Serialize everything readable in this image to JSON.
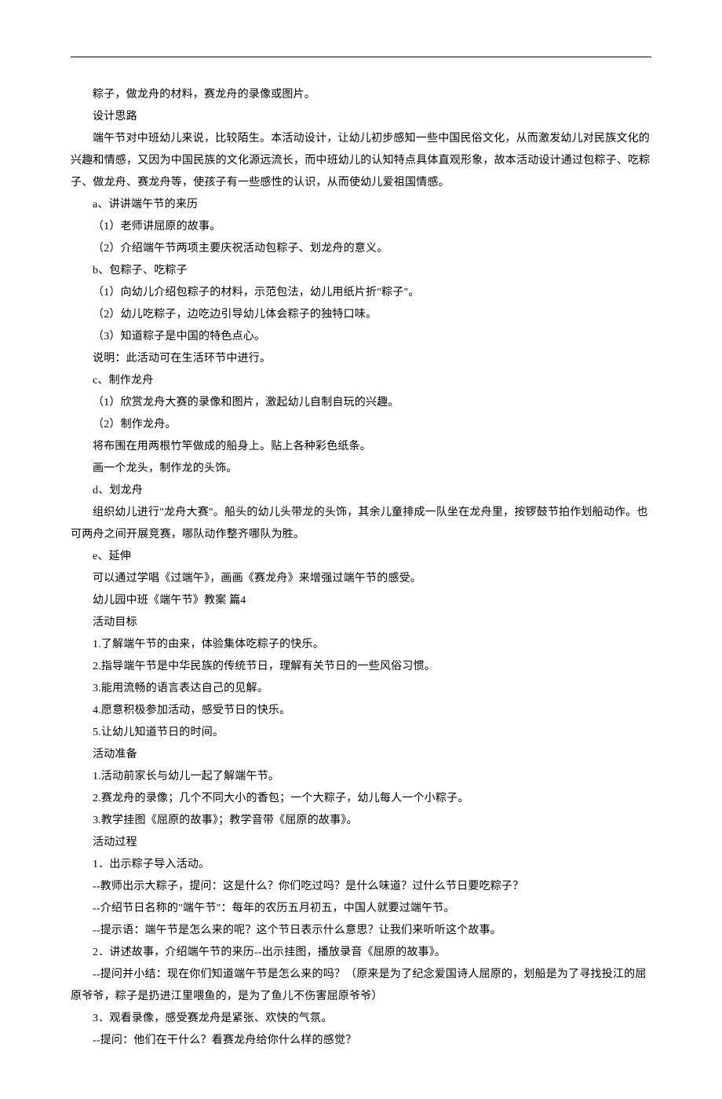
{
  "lines": [
    "粽子，做龙舟的材料，赛龙舟的录像或图片。",
    "设计思路",
    "端午节对中班幼儿来说，比较陌生。本活动设计，让幼儿初步感知一些中国民俗文化，从而激发幼儿对民族文化的兴趣和情感，又因为中国民族的文化源远流长，而中班幼儿的认知特点具体直观形象，故本活动设计通过包粽子、吃粽子、做龙舟、赛龙舟等，使孩子有一些感性的认识，从而使幼儿爱祖国情感。",
    "a、讲讲端午节的来历",
    "（1）老师讲屈原的故事。",
    "（2）介绍端午节两项主要庆祝活动包粽子、划龙舟的意义。",
    "b、包粽子、吃粽子",
    "（1）向幼儿介绍包粽子的材料，示范包法，幼儿用纸片折\"粽子\"。",
    "（2）幼儿吃粽子，边吃边引导幼儿体会粽子的独特口味。",
    "（3）知道粽子是中国的特色点心。",
    "说明：此活动可在生活环节中进行。",
    "c、制作龙舟",
    "（1）欣赏龙舟大赛的录像和图片，激起幼儿自制自玩的兴趣。",
    "（2）制作龙舟。",
    "将布围在用两根竹竿做成的船身上。贴上各种彩色纸条。",
    "画一个龙头，制作龙的头饰。",
    "d、划龙舟",
    "组织幼儿进行\"龙舟大赛\"。船头的幼儿头带龙的头饰，其余儿童排成一队坐在龙舟里，按锣鼓节拍作划船动作。也可两舟之间开展竞赛，哪队动作整齐哪队为胜。",
    "e、延伸",
    "可以通过学唱《过端午》，画画《赛龙舟》来增强过端午节的感受。",
    "幼儿园中班《端午节》教案 篇4",
    "活动目标",
    "1.了解端午节的由来，体验集体吃粽子的快乐。",
    "2.指导端午节是中华民族的传统节日，理解有关节日的一些风俗习惯。",
    "3.能用流畅的语言表达自己的见解。",
    "4.愿意积极参加活动，感受节日的快乐。",
    "5.让幼儿知道节日的时间。",
    "活动准备",
    "1.活动前家长与幼儿一起了解端午节。",
    "2.赛龙舟的录像；几个不同大小的香包；一个大粽子，幼儿每人一个小粽子。",
    "3.教学挂图《屈原的故事》；教学音带《屈原的故事》。",
    "活动过程",
    "1．出示粽子导入活动。",
    "--教师出示大粽子，提问：这是什么？你们吃过吗？是什么味道？过什么节日要吃粽子？",
    "--介绍节日名称的\"端午节\"：每年的农历五月初五，中国人就要过端午节。",
    "--提示语：端午节是怎么来的呢？这个节日表示什么意思？让我们来听听这个故事。",
    "2．讲述故事，介绍端午节的来历--出示挂图，播放录音《屈原的故事》。",
    "--提问并小结：现在你们知道端午节是怎么来的吗？（原来是为了纪念爱国诗人屈原的，划船是为了寻找投江的屈原爷爷，粽子是扔进江里喂鱼的，是为了鱼儿不伤害屈原爷爷）",
    "3．观看录像，感受赛龙舟是紧张、欢快的气氛。",
    "--提问：他们在干什么？看赛龙舟给你什么样的感觉？"
  ]
}
